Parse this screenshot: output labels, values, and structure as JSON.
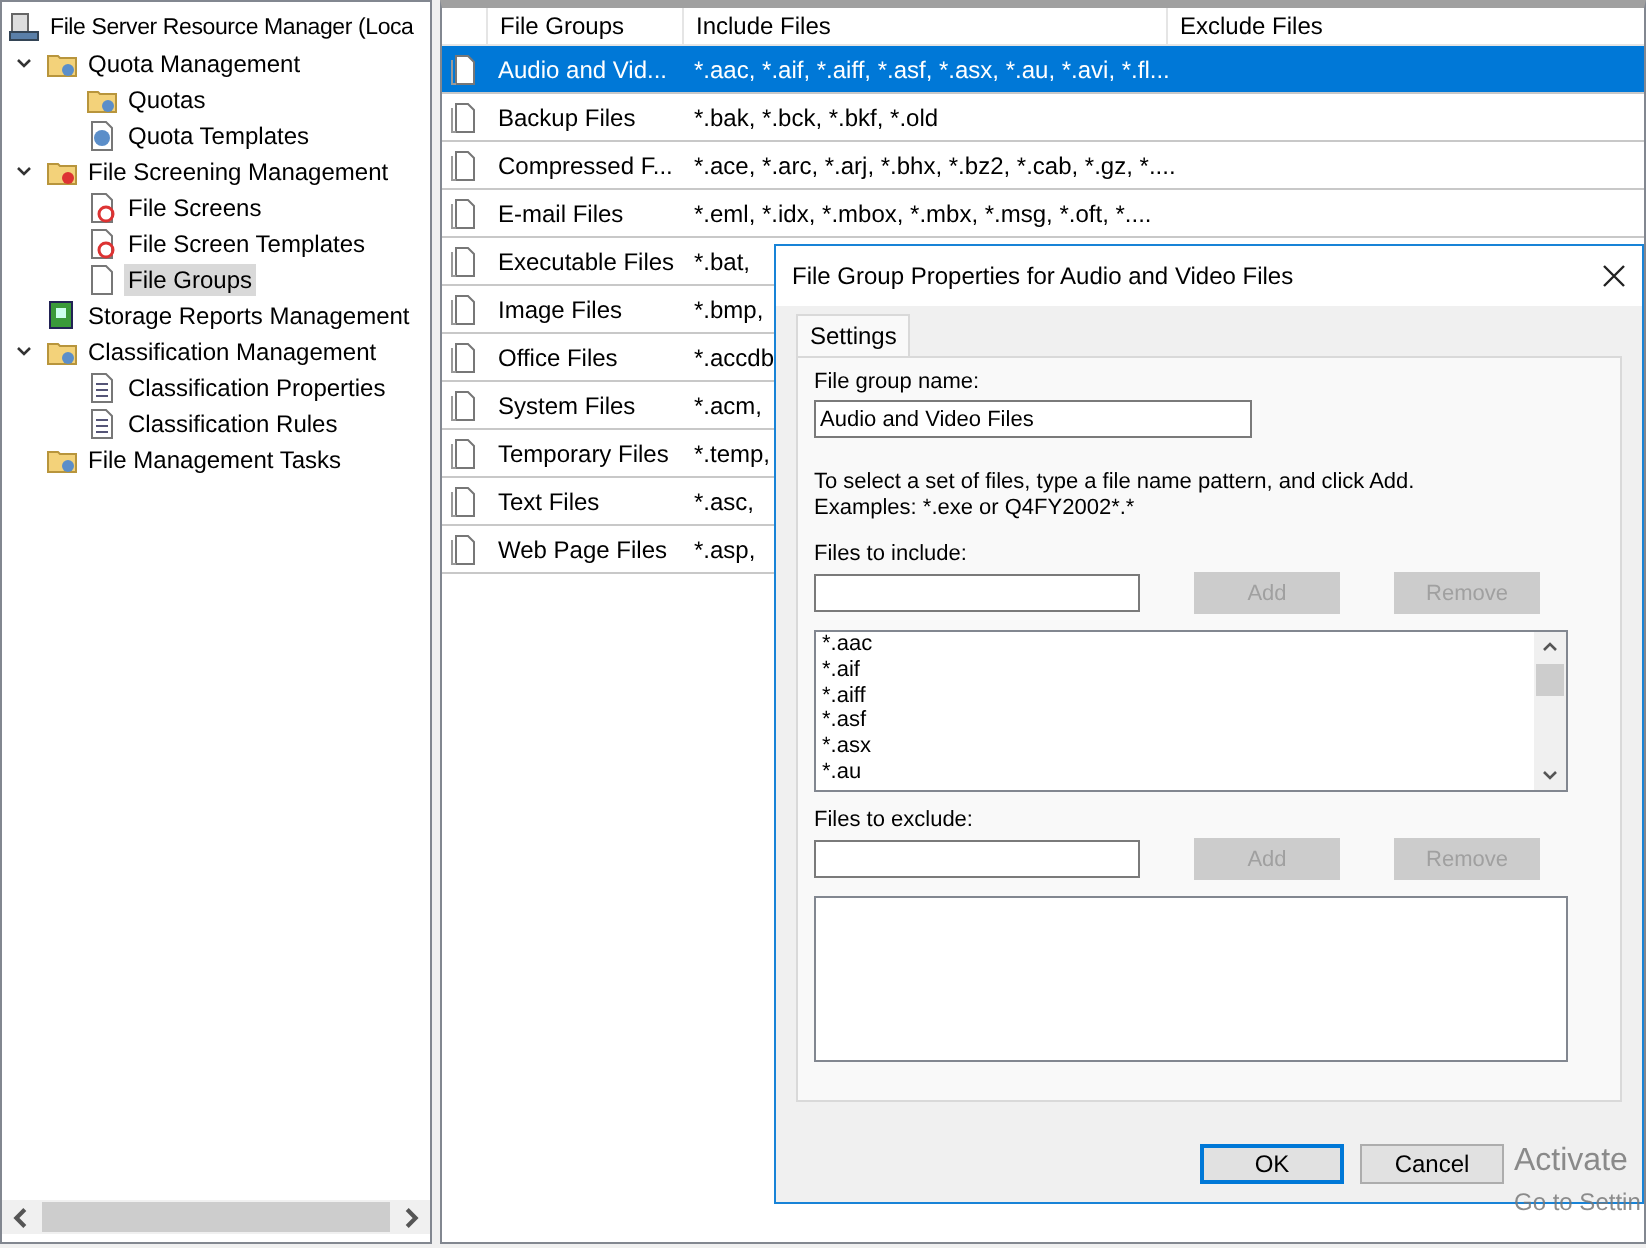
{
  "tree": {
    "root": {
      "label": "File Server Resource Manager (Loca"
    },
    "items": [
      {
        "label": "Quota Management",
        "expanded": true,
        "selected": false,
        "children": [
          {
            "label": "Quotas",
            "selected": false
          },
          {
            "label": "Quota Templates",
            "selected": false
          }
        ]
      },
      {
        "label": "File Screening Management",
        "expanded": true,
        "selected": false,
        "children": [
          {
            "label": "File Screens",
            "selected": false
          },
          {
            "label": "File Screen Templates",
            "selected": false
          },
          {
            "label": "File Groups",
            "selected": true
          }
        ]
      },
      {
        "label": "Storage Reports Management",
        "selected": false
      },
      {
        "label": "Classification Management",
        "expanded": true,
        "selected": false,
        "children": [
          {
            "label": "Classification Properties",
            "selected": false
          },
          {
            "label": "Classification Rules",
            "selected": false
          }
        ]
      },
      {
        "label": "File Management Tasks",
        "selected": false
      }
    ]
  },
  "table": {
    "columns": [
      "File Groups",
      "Include Files",
      "Exclude Files"
    ],
    "rows": [
      {
        "name": "Audio and Vid...",
        "include": "*.aac, *.aif, *.aiff, *.asf, *.asx, *.au, *.avi, *.fl...",
        "selected": true
      },
      {
        "name": "Backup Files",
        "include": "*.bak, *.bck, *.bkf, *.old",
        "selected": false
      },
      {
        "name": "Compressed F...",
        "include": "*.ace, *.arc, *.arj, *.bhx, *.bz2, *.cab, *.gz, *....",
        "selected": false
      },
      {
        "name": "E-mail Files",
        "include": "*.eml, *.idx, *.mbox, *.mbx, *.msg, *.oft, *....",
        "selected": false
      },
      {
        "name": "Executable Files",
        "include": "*.bat,",
        "selected": false
      },
      {
        "name": "Image Files",
        "include": "*.bmp,",
        "selected": false
      },
      {
        "name": "Office Files",
        "include": "*.accdb",
        "selected": false
      },
      {
        "name": "System Files",
        "include": "*.acm,",
        "selected": false
      },
      {
        "name": "Temporary Files",
        "include": "*.temp,",
        "selected": false
      },
      {
        "name": "Text Files",
        "include": "*.asc,",
        "selected": false
      },
      {
        "name": "Web Page Files",
        "include": "*.asp,",
        "selected": false
      }
    ]
  },
  "dialog": {
    "title": "File Group Properties for Audio and Video Files",
    "tabs": [
      {
        "label": "Settings",
        "selected": true
      }
    ],
    "name_label": "File group name:",
    "name_value": "Audio and Video Files",
    "instructions": [
      "To select a set of files, type a file name pattern, and click Add.",
      "Examples: *.exe or Q4FY2002*.*"
    ],
    "include": {
      "label": "Files to include:",
      "add": {
        "label": "Add",
        "disabled": true
      },
      "remove": {
        "label": "Remove",
        "disabled": true
      },
      "items": [
        "*.aac",
        "*.aif",
        "*.aiff",
        "*.asf",
        "*.asx",
        "*.au"
      ]
    },
    "exclude": {
      "label": "Files to exclude:",
      "add": {
        "label": "Add",
        "disabled": true
      },
      "remove": {
        "label": "Remove",
        "disabled": true
      }
    },
    "buttons": [
      {
        "label": "OK",
        "default": true
      },
      {
        "label": "Cancel",
        "default": false
      }
    ]
  },
  "activation_notice": [
    "Activate",
    "Go to Settin"
  ]
}
